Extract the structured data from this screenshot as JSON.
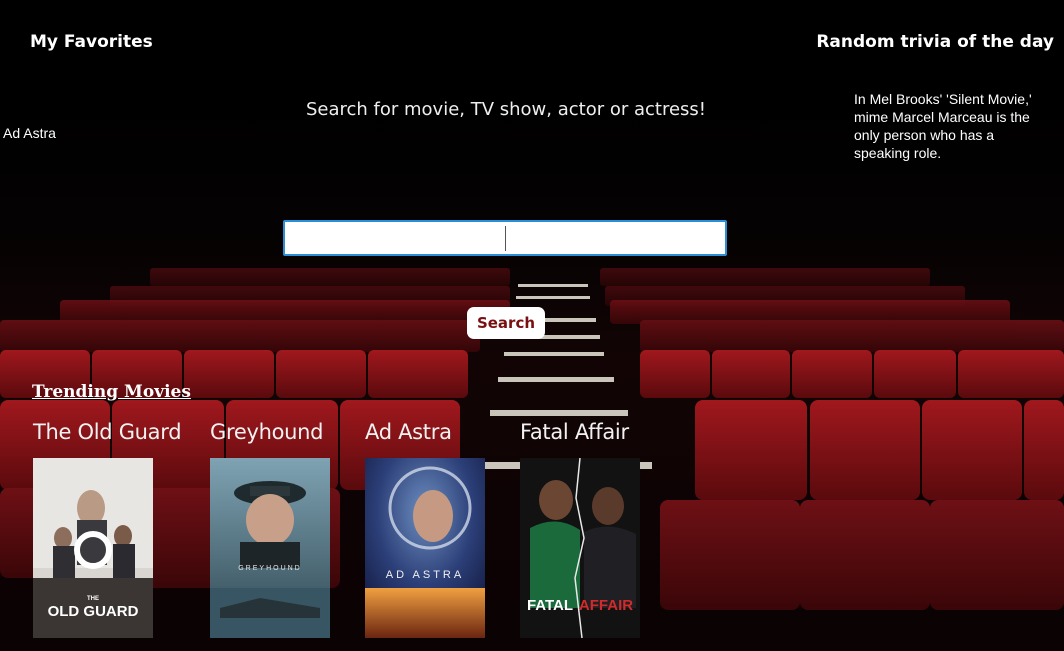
{
  "favorites": {
    "title": "My Favorites",
    "items": [
      "Ad Astra"
    ]
  },
  "trivia": {
    "title": "Random trivia of the day",
    "text": "In Mel Brooks' 'Silent Movie,' mime Marcel Marceau is the only person who has a speaking role."
  },
  "search": {
    "prompt": "Search for movie, TV show, actor or actress!",
    "value": "",
    "button_label": "Search"
  },
  "trending": {
    "title": "Trending Movies",
    "movies": [
      {
        "title": "The Old Guard",
        "poster_text_1": "THE",
        "poster_text_2": "OLD GUARD"
      },
      {
        "title": "Greyhound",
        "poster_text_1": "GREYHOUND"
      },
      {
        "title": "Ad Astra",
        "poster_text_1": "AD ASTRA"
      },
      {
        "title": "Fatal Affair",
        "poster_text_1": "FATAL",
        "poster_text_2": "AFFAIR"
      }
    ]
  },
  "colors": {
    "accent": "#7a0f12",
    "seat_red": "#8e1418",
    "input_border": "#2a8fd6"
  }
}
